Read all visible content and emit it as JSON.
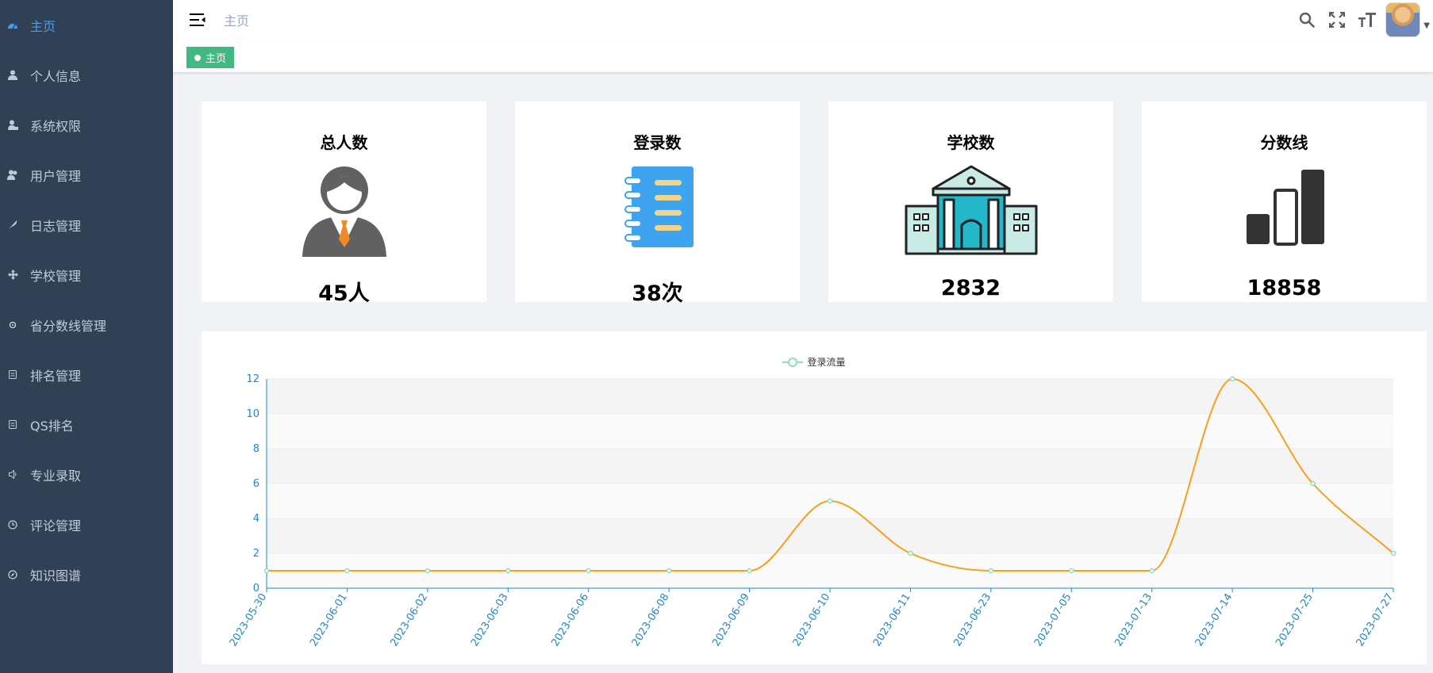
{
  "sidebar": {
    "items": [
      {
        "label": "主页",
        "icon": "dashboard-icon",
        "active": true
      },
      {
        "label": "个人信息",
        "icon": "user-icon"
      },
      {
        "label": "系统权限",
        "icon": "user-lock-icon"
      },
      {
        "label": "用户管理",
        "icon": "users-icon"
      },
      {
        "label": "日志管理",
        "icon": "feather-icon"
      },
      {
        "label": "学校管理",
        "icon": "move-icon"
      },
      {
        "label": "省分数线管理",
        "icon": "settings-icon"
      },
      {
        "label": "排名管理",
        "icon": "list-icon"
      },
      {
        "label": "QS排名",
        "icon": "list-icon"
      },
      {
        "label": "专业录取",
        "icon": "speaker-icon"
      },
      {
        "label": "评论管理",
        "icon": "clock-icon"
      },
      {
        "label": "知识图谱",
        "icon": "compass-icon"
      }
    ]
  },
  "header": {
    "breadcrumb": "主页",
    "icons": [
      "search-icon",
      "fullscreen-icon",
      "font-size-icon"
    ]
  },
  "tags": {
    "active_tag": "主页"
  },
  "cards": [
    {
      "title": "总人数",
      "value": "45人",
      "icon": "person-icon"
    },
    {
      "title": "登录数",
      "value": "38次",
      "icon": "notebook-icon"
    },
    {
      "title": "学校数",
      "value": "2832",
      "icon": "school-building-icon"
    },
    {
      "title": "分数线",
      "value": "18858",
      "icon": "bar-level-icon"
    }
  ],
  "colors": {
    "sidebar_bg": "#304156",
    "active_menu": "#409eff",
    "tag_green": "#42b983",
    "line_orange": "#f8a01c",
    "point_green": "#8ee0b8",
    "axis_blue": "#1e88c7"
  },
  "chart_data": {
    "type": "line",
    "legend": "登录流量",
    "x": [
      "2023-05-30",
      "2023-06-01",
      "2023-06-02",
      "2023-06-03",
      "2023-06-06",
      "2023-06-08",
      "2023-06-09",
      "2023-06-10",
      "2023-06-11",
      "2023-06-23",
      "2023-07-05",
      "2023-07-13",
      "2023-07-14",
      "2023-07-25",
      "2023-07-27"
    ],
    "series": [
      {
        "name": "登录流量",
        "values": [
          1,
          1,
          1,
          1,
          1,
          1,
          1,
          5,
          2,
          1,
          1,
          1,
          12,
          6,
          2
        ]
      }
    ],
    "ylim": [
      0,
      12
    ],
    "yticks": [
      0,
      2,
      4,
      6,
      8,
      10,
      12
    ],
    "grid": true
  }
}
